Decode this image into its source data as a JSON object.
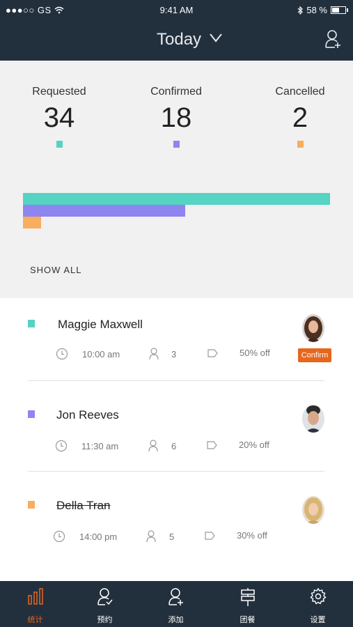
{
  "status_bar": {
    "carrier": "●●●○○ GS",
    "time": "9:41 AM",
    "battery": "58 %"
  },
  "header": {
    "title": "Today"
  },
  "stats": [
    {
      "label": "Requested",
      "value": "34",
      "color": "#55d3c3"
    },
    {
      "label": "Confirmed",
      "value": "18",
      "color": "#8f85f0"
    },
    {
      "label": "Cancelled",
      "value": "2",
      "color": "#f8ad5f"
    }
  ],
  "show_all": "SHOW ALL",
  "reservations": [
    {
      "name": "Maggie Maxwell",
      "time": "10:00 am",
      "party": "3",
      "discount": "50% off",
      "status_color": "#55d3c3",
      "action": "Confirm",
      "struck": false
    },
    {
      "name": "Jon Reeves",
      "time": "11:30 am",
      "party": "6",
      "discount": "20% off",
      "status_color": "#8f85f0",
      "struck": false
    },
    {
      "name": "Della Tran",
      "time": "14:00 pm",
      "party": "5",
      "discount": "30% off",
      "status_color": "#f8ad5f",
      "struck": true
    }
  ],
  "tabs": [
    {
      "label": "统计",
      "icon": "bar-chart-icon",
      "active": true
    },
    {
      "label": "预约",
      "icon": "person-check-icon"
    },
    {
      "label": "添加",
      "icon": "person-add-icon"
    },
    {
      "label": "团餐",
      "icon": "signpost-icon"
    },
    {
      "label": "设置",
      "icon": "gear-icon"
    }
  ],
  "colors": {
    "header_bg": "#22303e",
    "accent": "#e6661e"
  }
}
